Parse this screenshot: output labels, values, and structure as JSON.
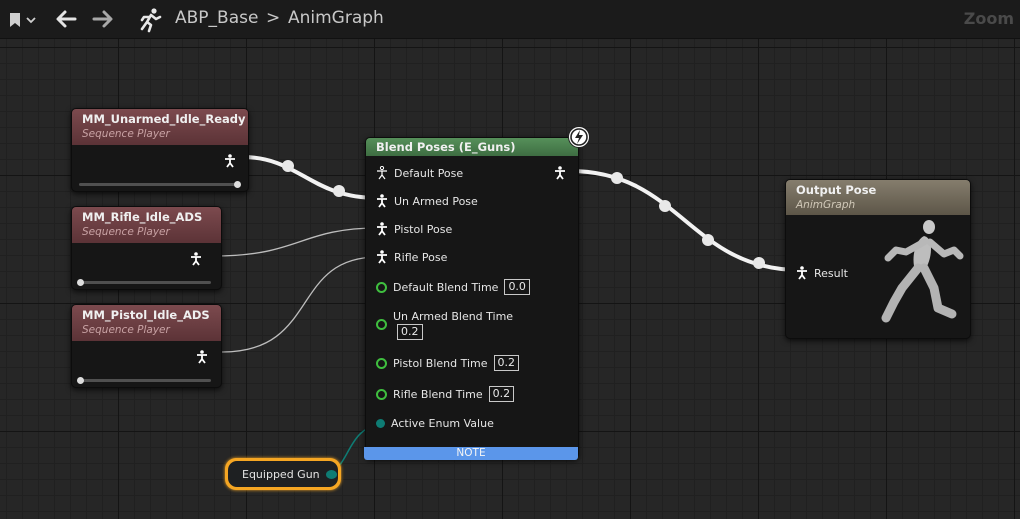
{
  "toolbar": {
    "bookmark_icon": "bookmark-icon",
    "back_icon": "arrow-left-icon",
    "forward_icon": "arrow-right-icon",
    "asset_icon": "running-man-icon",
    "breadcrumb_root": "ABP_Base",
    "breadcrumb_separator": ">",
    "breadcrumb_leaf": "AnimGraph",
    "zoom_label": "Zoom"
  },
  "sequence_players": [
    {
      "title": "MM_Unarmed_Idle_Ready",
      "subtitle": "Sequence Player",
      "slider": 1.0
    },
    {
      "title": "MM_Rifle_Idle_ADS",
      "subtitle": "Sequence Player",
      "slider": 0.0
    },
    {
      "title": "MM_Pistol_Idle_ADS",
      "subtitle": "Sequence Player",
      "slider": 0.0
    }
  ],
  "blend_node": {
    "title": "Blend Poses (E_Guns)",
    "pins": {
      "default_pose": "Default Pose",
      "unarmed_pose": "Un Armed Pose",
      "pistol_pose": "Pistol Pose",
      "rifle_pose": "Rifle Pose",
      "default_blend_time": "Default Blend Time",
      "unarmed_blend_time": "Un Armed Blend Time",
      "pistol_blend_time": "Pistol Blend Time",
      "rifle_blend_time": "Rifle Blend Time",
      "active_enum_value": "Active Enum Value"
    },
    "values": {
      "default_blend_time": "0.0",
      "unarmed_blend_time": "0.2",
      "pistol_blend_time": "0.2",
      "rifle_blend_time": "0.2"
    },
    "note": "NOTE"
  },
  "output_node": {
    "title": "Output Pose",
    "subtitle": "AnimGraph",
    "result_pin": "Result"
  },
  "variable_node": {
    "label": "Equipped Gun"
  },
  "colors": {
    "sequence_header": "#7c4a4e",
    "blend_header": "#56905a",
    "output_header": "#857d6d",
    "exec_wire": "#ffffff",
    "float_pin": "#3fbf3f",
    "enum_pin": "#0e7c74",
    "variable_outline": "#f5a623",
    "note_bar": "#5b96ea"
  }
}
